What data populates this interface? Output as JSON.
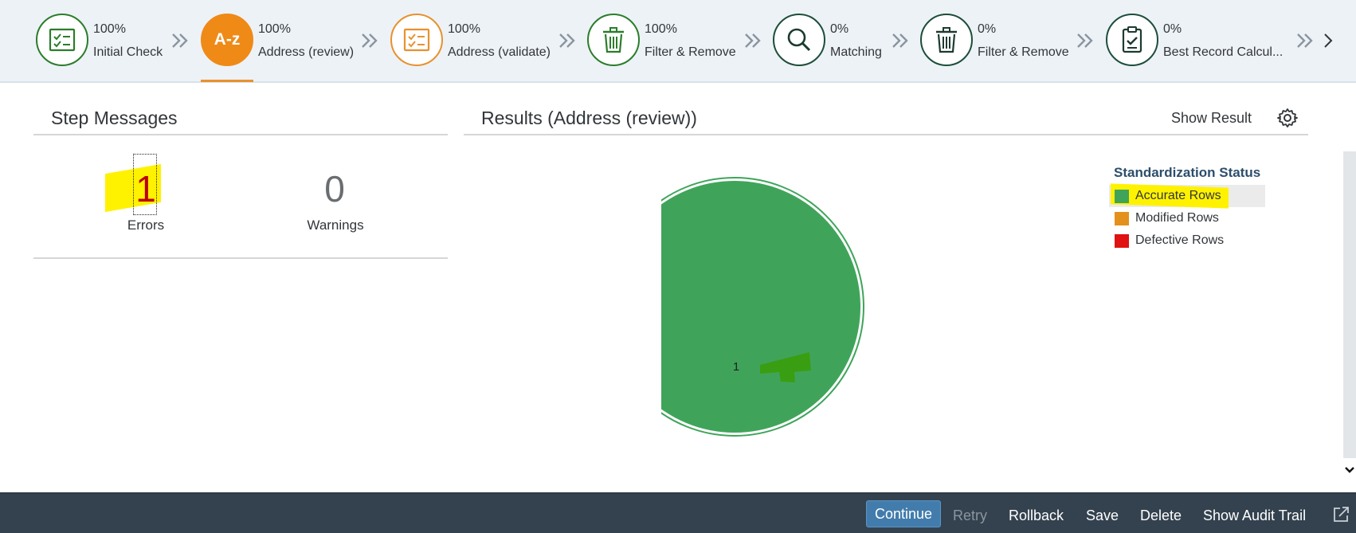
{
  "process_flow": {
    "steps": [
      {
        "percent": "100%",
        "label": "Initial Check",
        "icon": "checklist-icon",
        "state": "done"
      },
      {
        "percent": "100%",
        "label": "Address (review)",
        "icon": "a-z-icon",
        "icon_text": "A-z",
        "state": "active"
      },
      {
        "percent": "100%",
        "label": "Address (validate)",
        "icon": "checklist-icon",
        "state": "warning"
      },
      {
        "percent": "100%",
        "label": "Filter & Remove",
        "icon": "trash-icon",
        "state": "done"
      },
      {
        "percent": "0%",
        "label": "Matching",
        "icon": "search-icon",
        "state": "pending"
      },
      {
        "percent": "0%",
        "label": "Filter & Remove",
        "icon": "trash-icon",
        "state": "pending"
      },
      {
        "percent": "0%",
        "label": "Best Record Calcul...",
        "icon": "clipboard-check-icon",
        "state": "pending"
      }
    ]
  },
  "step_messages": {
    "title": "Step Messages",
    "errors": {
      "count": "1",
      "label": "Errors"
    },
    "warnings": {
      "count": "0",
      "label": "Warnings"
    }
  },
  "results": {
    "title": "Results (Address (review))",
    "show_result_label": "Show Result",
    "chart_data": {
      "type": "pie",
      "categories": [
        "Accurate Rows",
        "Modified Rows",
        "Defective Rows"
      ],
      "values": [
        1,
        0,
        0
      ],
      "data_labels": [
        "1"
      ],
      "legend_title": "Standardization Status",
      "legend_position": "top-right",
      "colors": [
        "#3fa45a",
        "#e3901d",
        "#e01212"
      ]
    }
  },
  "footer": {
    "continue_label": "Continue",
    "retry_label": "Retry",
    "rollback_label": "Rollback",
    "save_label": "Save",
    "delete_label": "Delete",
    "audit_label": "Show Audit Trail"
  },
  "colors": {
    "done": "#2b7d2b",
    "active": "#ef8a17",
    "warning": "#e8912f",
    "header_bg": "#edf2f7",
    "footer_bg": "#34424f",
    "error_number": "#bb0000",
    "highlight": "#fff200"
  }
}
